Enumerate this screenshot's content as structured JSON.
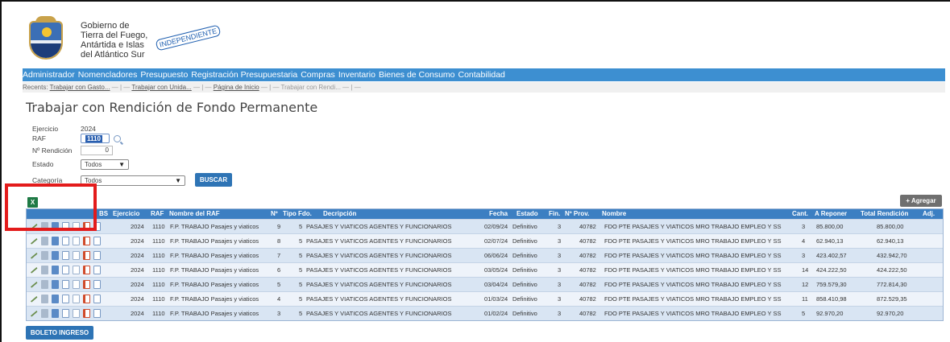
{
  "header": {
    "gov_lines": [
      "Gobierno de",
      "Tierra del Fuego,",
      "Antártida e Islas",
      "del Atlántico Sur"
    ],
    "stamp_text": "INDEPENDIENTE"
  },
  "menu": [
    "Administrador",
    "Nomencladores",
    "Presupuesto",
    "Registración Presupuestaria",
    "Compras",
    "Inventario",
    "Bienes de Consumo",
    "Contabilidad"
  ],
  "recents": {
    "label": "Recents:",
    "items": [
      "Trabajar con Gasto...",
      "Trabajar con Unida...",
      "Página de Inicio",
      "Trabajar con Rendi..."
    ]
  },
  "page_title": "Trabajar con Rendición de Fondo Permanente",
  "form": {
    "ejercicio_label": "Ejercicio",
    "ejercicio_value": "2024",
    "raf_label": "RAF",
    "raf_value": "1110",
    "rendicion_label": "Nº Rendición",
    "rendicion_value": "0",
    "estado_label": "Estado",
    "estado_value": "Todos",
    "categoria_label": "Categoría",
    "categoria_value": "Todos",
    "buscar_label": "BUSCAR"
  },
  "toolbar": {
    "agregar_label": "+ Agregar"
  },
  "table": {
    "headers": [
      "BS",
      "Ejercicio",
      "RAF",
      "Nombre del RAF",
      "Nº",
      "Tipo Fdo.",
      "Decripción",
      "Fecha",
      "Estado",
      "Fin.",
      "Nº Prov.",
      "Nombre",
      "Cant.",
      "A Reponer",
      "Total Rendición",
      "Adj."
    ],
    "rows": [
      {
        "ejercicio": "2024",
        "raf": "1110",
        "nombre_raf": "F.P. TRABAJO Pasajes y viaticos",
        "n": "9",
        "tipo": "5",
        "descripcion": "PASAJES Y VIATICOS AGENTES Y FUNCIONARIOS",
        "fecha": "02/09/24",
        "estado": "Definitivo",
        "fin": "3",
        "nprov": "40782",
        "nombre": "FDO PTE PASAJES Y VIATICOS MRO TRABAJO EMPLEO Y SS",
        "cant": "3",
        "reponer": "85.800,00",
        "total": "85.800,00"
      },
      {
        "ejercicio": "2024",
        "raf": "1110",
        "nombre_raf": "F.P. TRABAJO Pasajes y viaticos",
        "n": "8",
        "tipo": "5",
        "descripcion": "PASAJES Y VIATICOS AGENTES Y FUNCIONARIOS",
        "fecha": "02/07/24",
        "estado": "Definitivo",
        "fin": "3",
        "nprov": "40782",
        "nombre": "FDO PTE PASAJES Y VIATICOS MRO TRABAJO EMPLEO Y SS",
        "cant": "4",
        "reponer": "62.940,13",
        "total": "62.940,13"
      },
      {
        "ejercicio": "2024",
        "raf": "1110",
        "nombre_raf": "F.P. TRABAJO Pasajes y viaticos",
        "n": "7",
        "tipo": "5",
        "descripcion": "PASAJES Y VIATICOS AGENTES Y FUNCIONARIOS",
        "fecha": "06/06/24",
        "estado": "Definitivo",
        "fin": "3",
        "nprov": "40782",
        "nombre": "FDO PTE PASAJES Y VIATICOS MRO TRABAJO EMPLEO Y SS",
        "cant": "3",
        "reponer": "423.402,57",
        "total": "432.942,70"
      },
      {
        "ejercicio": "2024",
        "raf": "1110",
        "nombre_raf": "F.P. TRABAJO Pasajes y viaticos",
        "n": "6",
        "tipo": "5",
        "descripcion": "PASAJES Y VIATICOS AGENTES Y FUNCIONARIOS",
        "fecha": "03/05/24",
        "estado": "Definitivo",
        "fin": "3",
        "nprov": "40782",
        "nombre": "FDO PTE PASAJES Y VIATICOS MRO TRABAJO EMPLEO Y SS",
        "cant": "14",
        "reponer": "424.222,50",
        "total": "424.222,50"
      },
      {
        "ejercicio": "2024",
        "raf": "1110",
        "nombre_raf": "F.P. TRABAJO Pasajes y viaticos",
        "n": "5",
        "tipo": "5",
        "descripcion": "PASAJES Y VIATICOS AGENTES Y FUNCIONARIOS",
        "fecha": "03/04/24",
        "estado": "Definitivo",
        "fin": "3",
        "nprov": "40782",
        "nombre": "FDO PTE PASAJES Y VIATICOS MRO TRABAJO EMPLEO Y SS",
        "cant": "12",
        "reponer": "759.579,30",
        "total": "772.814,30"
      },
      {
        "ejercicio": "2024",
        "raf": "1110",
        "nombre_raf": "F.P. TRABAJO Pasajes y viaticos",
        "n": "4",
        "tipo": "5",
        "descripcion": "PASAJES Y VIATICOS AGENTES Y FUNCIONARIOS",
        "fecha": "01/03/24",
        "estado": "Definitivo",
        "fin": "3",
        "nprov": "40782",
        "nombre": "FDO PTE PASAJES Y VIATICOS MRO TRABAJO EMPLEO Y SS",
        "cant": "11",
        "reponer": "858.410,98",
        "total": "872.529,35"
      },
      {
        "ejercicio": "2024",
        "raf": "1110",
        "nombre_raf": "F.P. TRABAJO Pasajes y viaticos",
        "n": "3",
        "tipo": "5",
        "descripcion": "PASAJES Y VIATICOS AGENTES Y FUNCIONARIOS",
        "fecha": "01/02/24",
        "estado": "Definitivo",
        "fin": "3",
        "nprov": "40782",
        "nombre": "FDO PTE PASAJES Y VIATICOS MRO TRABAJO EMPLEO Y SS",
        "cant": "5",
        "reponer": "92.970,20",
        "total": "92.970,20"
      }
    ]
  },
  "footer": {
    "boleto_label": "BOLETO INGRESO"
  },
  "colors": {
    "menubar": "#3d8fd1",
    "table_header": "#3c7fc2",
    "button": "#2e74b5",
    "highlight_box": "#e31b1b"
  }
}
